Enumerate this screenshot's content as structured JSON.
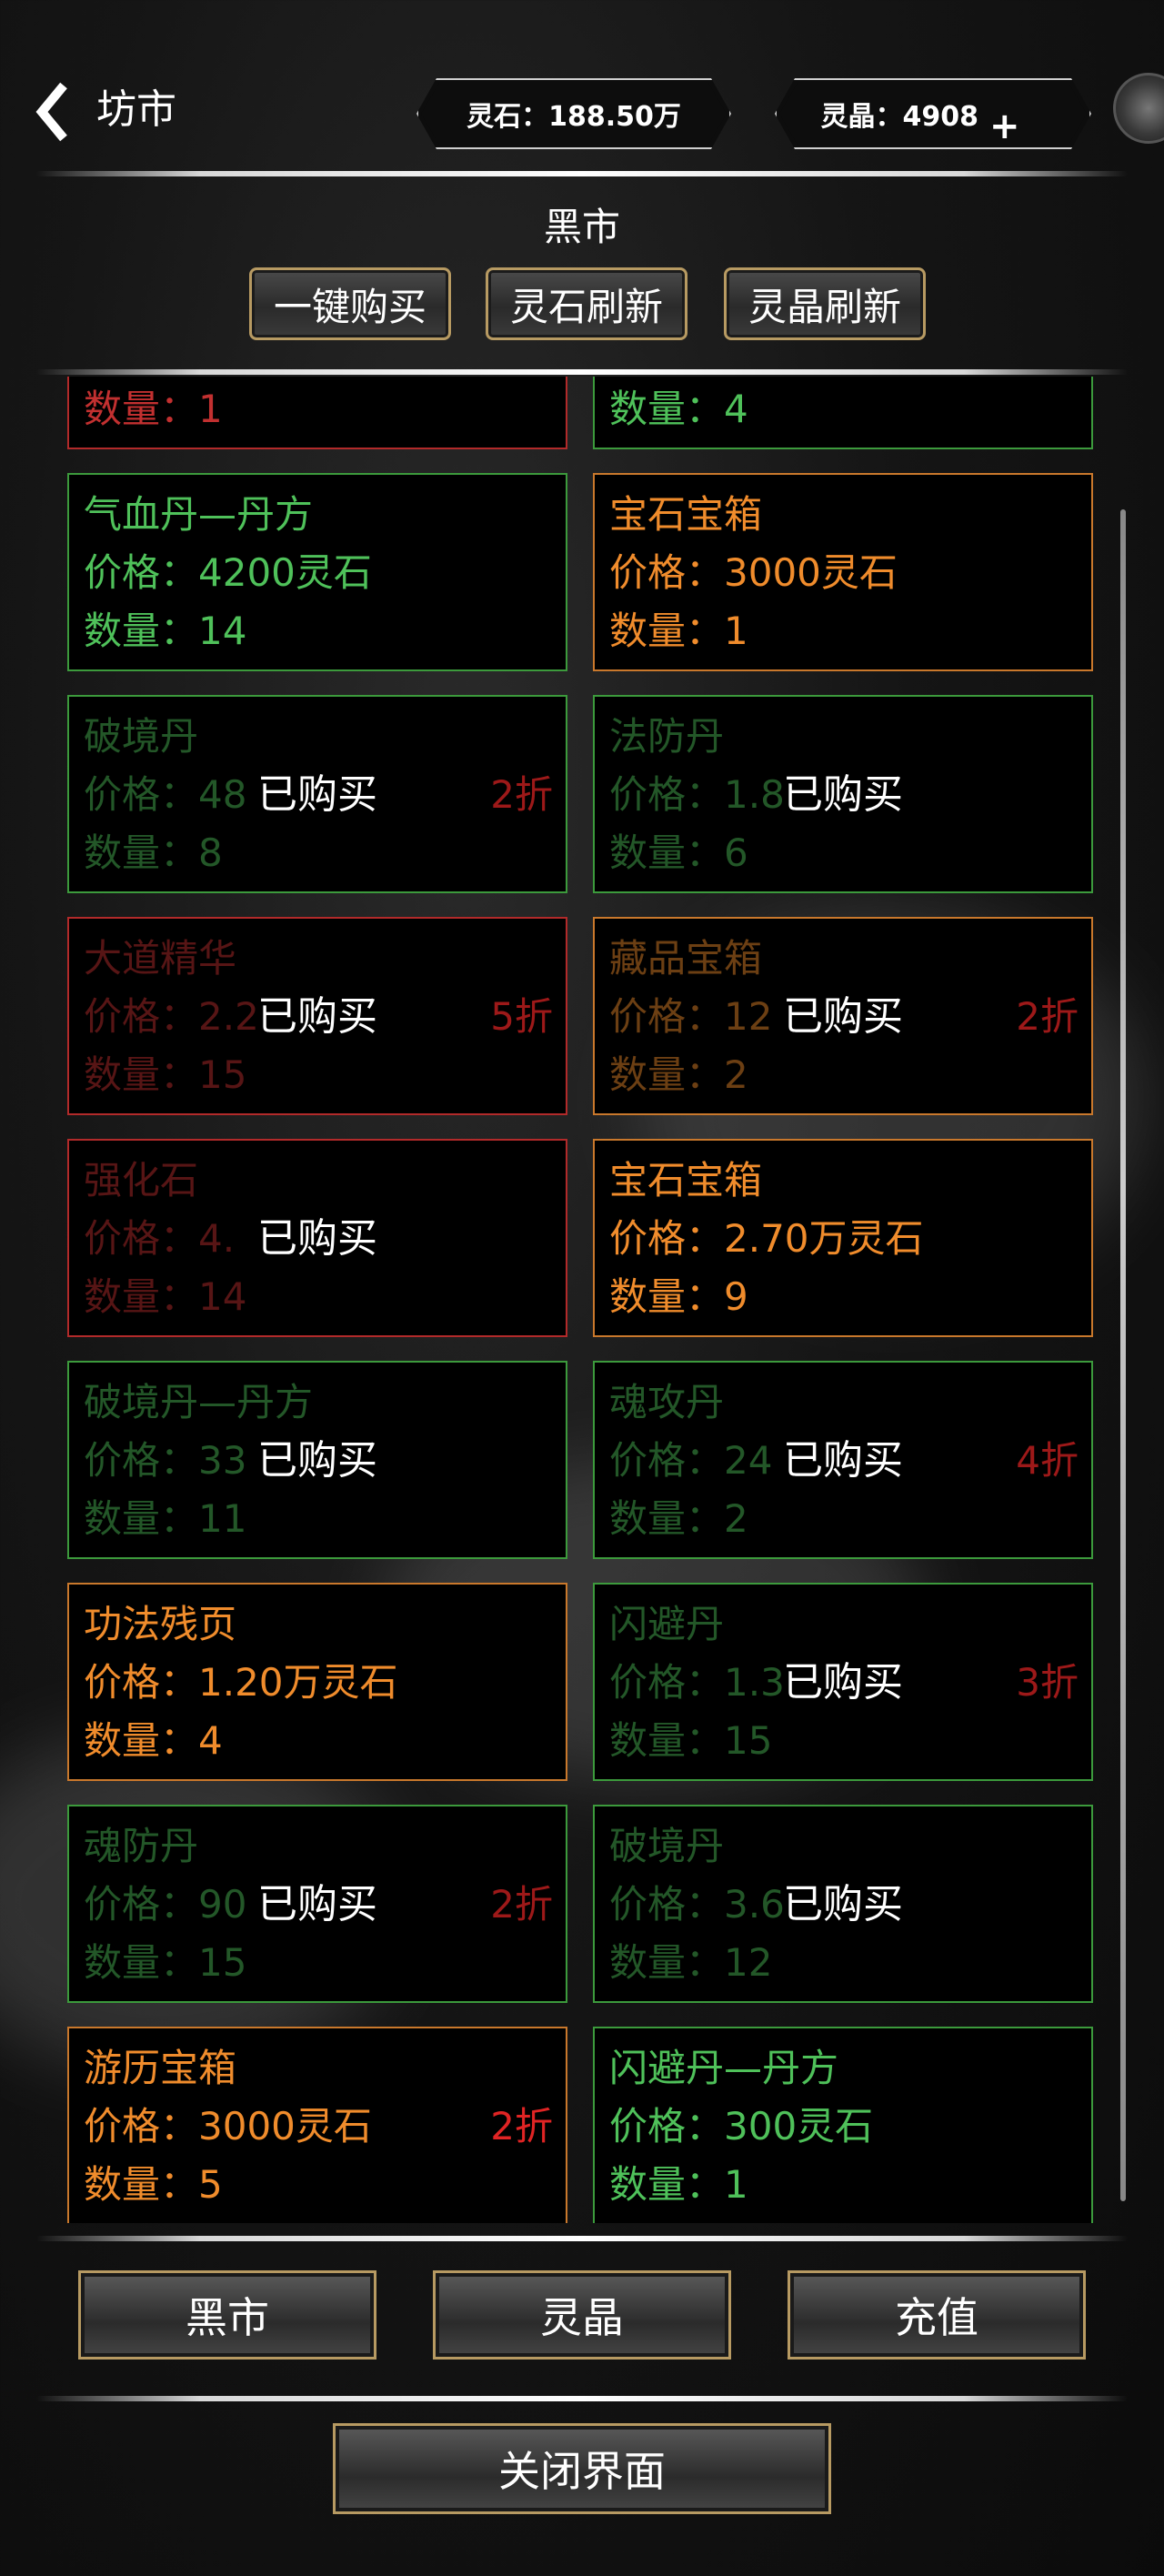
{
  "header": {
    "title": "坊市",
    "spirit_stone": "灵石：188.50万",
    "spirit_crystal": "灵晶：4908",
    "add_icon": "plus-icon"
  },
  "market": {
    "title": "黑市",
    "actions": [
      "一键购买",
      "灵石刷新",
      "灵晶刷新"
    ],
    "sold_label": "已购买",
    "items": [
      {
        "col": 0,
        "row": -1,
        "name": "",
        "price": "",
        "qty": "数量：1",
        "color": "red",
        "sold": false,
        "discount": ""
      },
      {
        "col": 1,
        "row": -1,
        "name": "",
        "price": "",
        "qty": "数量：4",
        "color": "green",
        "sold": false,
        "discount": ""
      },
      {
        "col": 0,
        "row": 0,
        "name": "气血丹—丹方",
        "price": "价格：4200灵石",
        "qty": "数量：14",
        "color": "green",
        "sold": false,
        "discount": ""
      },
      {
        "col": 1,
        "row": 0,
        "name": "宝石宝箱",
        "price": "价格：3000灵石",
        "qty": "数量：1",
        "color": "orange",
        "sold": false,
        "discount": ""
      },
      {
        "col": 0,
        "row": 1,
        "name": "破境丹",
        "price": "价格：48",
        "qty": "数量：8",
        "color": "green",
        "sold": true,
        "discount": "2折"
      },
      {
        "col": 1,
        "row": 1,
        "name": "法防丹",
        "price": "价格：1.8",
        "qty": "数量：6",
        "color": "green",
        "sold": true,
        "discount": ""
      },
      {
        "col": 0,
        "row": 2,
        "name": "大道精华",
        "price": "价格：2.2",
        "qty": "数量：15",
        "color": "red",
        "sold": true,
        "discount": "5折"
      },
      {
        "col": 1,
        "row": 2,
        "name": "藏品宝箱",
        "price": "价格：12",
        "qty": "数量：2",
        "color": "orange",
        "sold": true,
        "discount": "2折"
      },
      {
        "col": 0,
        "row": 3,
        "name": "强化石",
        "price": "价格：4.",
        "qty": "数量：14",
        "color": "red",
        "sold": true,
        "discount": ""
      },
      {
        "col": 1,
        "row": 3,
        "name": "宝石宝箱",
        "price": "价格：2.70万灵石",
        "qty": "数量：9",
        "color": "orange",
        "sold": false,
        "discount": ""
      },
      {
        "col": 0,
        "row": 4,
        "name": "破境丹—丹方",
        "price": "价格：33",
        "qty": "数量：11",
        "color": "green",
        "sold": true,
        "discount": ""
      },
      {
        "col": 1,
        "row": 4,
        "name": "魂攻丹",
        "price": "价格：24",
        "qty": "数量：2",
        "color": "green",
        "sold": true,
        "discount": "4折"
      },
      {
        "col": 0,
        "row": 5,
        "name": "功法残页",
        "price": "价格：1.20万灵石",
        "qty": "数量：4",
        "color": "orange",
        "sold": false,
        "discount": ""
      },
      {
        "col": 1,
        "row": 5,
        "name": "闪避丹",
        "price": "价格：1.3",
        "qty": "数量：15",
        "color": "green",
        "sold": true,
        "discount": "3折"
      },
      {
        "col": 0,
        "row": 6,
        "name": "魂防丹",
        "price": "价格：90",
        "qty": "数量：15",
        "color": "green",
        "sold": true,
        "discount": "2折"
      },
      {
        "col": 1,
        "row": 6,
        "name": "破境丹",
        "price": "价格：3.6",
        "qty": "数量：12",
        "color": "green",
        "sold": true,
        "discount": ""
      },
      {
        "col": 0,
        "row": 7,
        "name": "游历宝箱",
        "price": "价格：3000灵石",
        "qty": "数量：5",
        "color": "orange",
        "sold": false,
        "discount": "2折"
      },
      {
        "col": 1,
        "row": 7,
        "name": "闪避丹—丹方",
        "price": "价格：300灵石",
        "qty": "数量：1",
        "color": "green",
        "sold": false,
        "discount": ""
      }
    ]
  },
  "tabs": [
    "黑市",
    "灵晶",
    "充值"
  ],
  "close_label": "关闭界面",
  "colors": {
    "green": "#4fc15a",
    "orange": "#f08c2c",
    "red": "#c23030",
    "gold_border": "#b79a62"
  }
}
